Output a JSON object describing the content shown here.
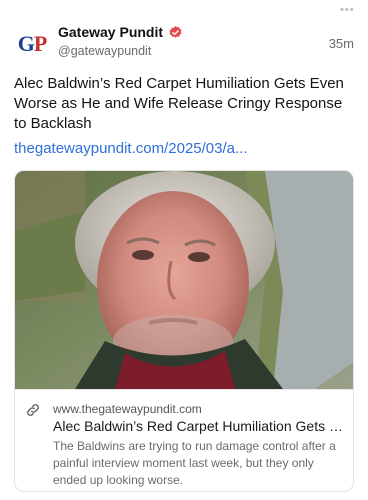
{
  "post": {
    "author": {
      "display_name": "Gateway Pundit",
      "handle": "@gatewaypundit",
      "avatar_initials_g": "G",
      "avatar_initials_p": "P",
      "verified_icon": "verified-badge-icon"
    },
    "timestamp": "35m",
    "text": "Alec Baldwin’s Red Carpet Humiliation Gets Even Worse as He and Wife Release Cringy Response to Backlash",
    "link": "thegatewaypundit.com/2025/03/a..."
  },
  "link_card": {
    "image_icon": "portrait-photo",
    "icon": "link-icon",
    "domain": "www.thegatewaypundit.com",
    "title": "Alec Baldwin’s Red Carpet Humiliation Gets Ev...",
    "description": "The Baldwins are trying to run damage control after a painful interview moment last week, but they only ended up looking worse."
  },
  "colors": {
    "link": "#2f6fd8",
    "verified": "#e5484d",
    "avatar_blue": "#1d3f8f",
    "avatar_red": "#c8312b"
  }
}
